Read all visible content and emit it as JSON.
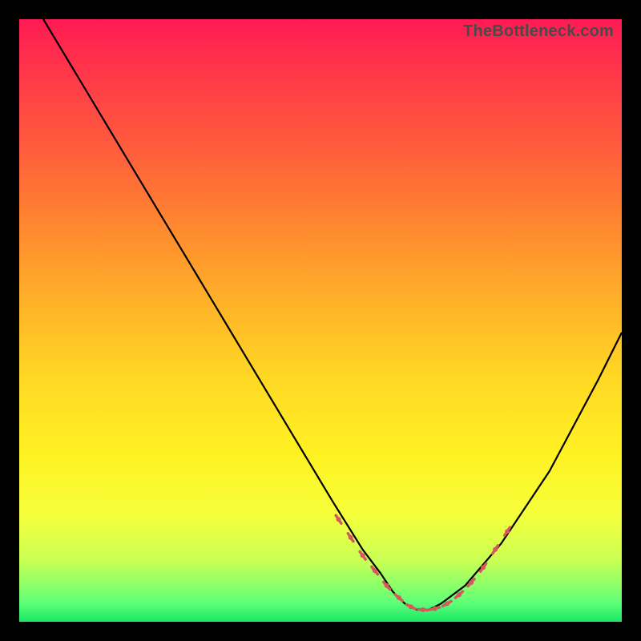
{
  "watermark": "TheBottleneck.com",
  "chart_data": {
    "type": "line",
    "title": "",
    "xlabel": "",
    "ylabel": "",
    "xlim": [
      0,
      100
    ],
    "ylim": [
      0,
      100
    ],
    "background_gradient": {
      "top": "#ff1a53",
      "bottom": "#19e765"
    },
    "series": [
      {
        "name": "bottleneck-curve",
        "x": [
          4,
          10,
          16,
          22,
          28,
          34,
          40,
          46,
          52,
          57,
          60,
          62,
          64,
          66,
          68,
          70,
          74,
          80,
          88,
          96,
          100
        ],
        "y": [
          100,
          90,
          80,
          70,
          60,
          50,
          40,
          30,
          20,
          12,
          8,
          5,
          3,
          2,
          2,
          3,
          6,
          13,
          25,
          40,
          48
        ]
      }
    ],
    "markers": {
      "name": "highlight-dashes",
      "x": [
        53,
        55,
        57,
        59,
        61,
        63,
        65,
        67,
        69,
        71,
        73,
        75,
        77,
        79,
        81
      ],
      "y": [
        17,
        14,
        11,
        8.5,
        6,
        4,
        2.5,
        2,
        2.2,
        3,
        4.5,
        6.5,
        9,
        12,
        15
      ]
    }
  }
}
